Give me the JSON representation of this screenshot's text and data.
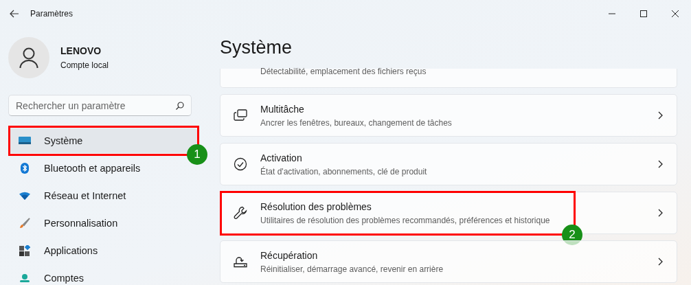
{
  "window": {
    "title": "Paramètres"
  },
  "account": {
    "name": "LENOVO",
    "type": "Compte local"
  },
  "search": {
    "placeholder": "Rechercher un paramètre"
  },
  "nav": [
    {
      "label": "Système",
      "selected": true,
      "callout": "1"
    },
    {
      "label": "Bluetooth et appareils",
      "selected": false
    },
    {
      "label": "Réseau et Internet",
      "selected": false
    },
    {
      "label": "Personnalisation",
      "selected": false
    },
    {
      "label": "Applications",
      "selected": false
    },
    {
      "label": "Comptes",
      "selected": false
    }
  ],
  "page_title": "Système",
  "cards": [
    {
      "subtitle": "Détectabilité, emplacement des fichiers reçus"
    },
    {
      "title": "Multitâche",
      "subtitle": "Ancrer les fenêtres, bureaux, changement de tâches"
    },
    {
      "title": "Activation",
      "subtitle": "État d'activation, abonnements, clé de produit"
    },
    {
      "title": "Résolution des problèmes",
      "subtitle": "Utilitaires de résolution des problèmes recommandés, préférences et historique",
      "callout": "2"
    },
    {
      "title": "Récupération",
      "subtitle": "Réinitialiser, démarrage avancé, revenir en arrière"
    }
  ]
}
